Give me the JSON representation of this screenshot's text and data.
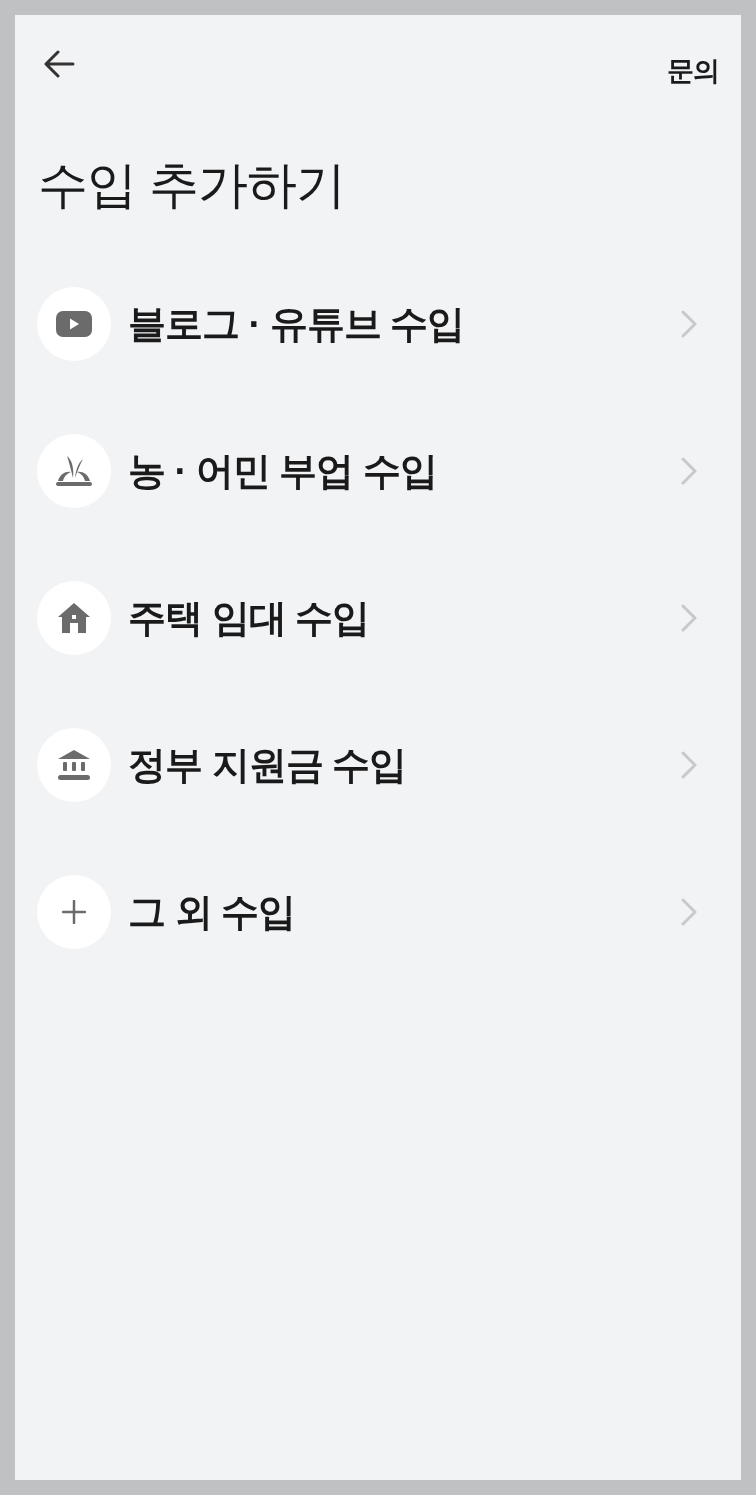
{
  "header": {
    "inquiry_link": "문의"
  },
  "title": "수입 추가하기",
  "items": [
    {
      "kind": "video",
      "label": "블로그 · 유튜브 수입"
    },
    {
      "kind": "sprout",
      "label": "농 · 어민 부업 수입"
    },
    {
      "kind": "house",
      "label": "주택 임대 수입"
    },
    {
      "kind": "bank",
      "label": "정부 지원금 수입"
    },
    {
      "kind": "plus",
      "label": "그 외 수입"
    }
  ]
}
